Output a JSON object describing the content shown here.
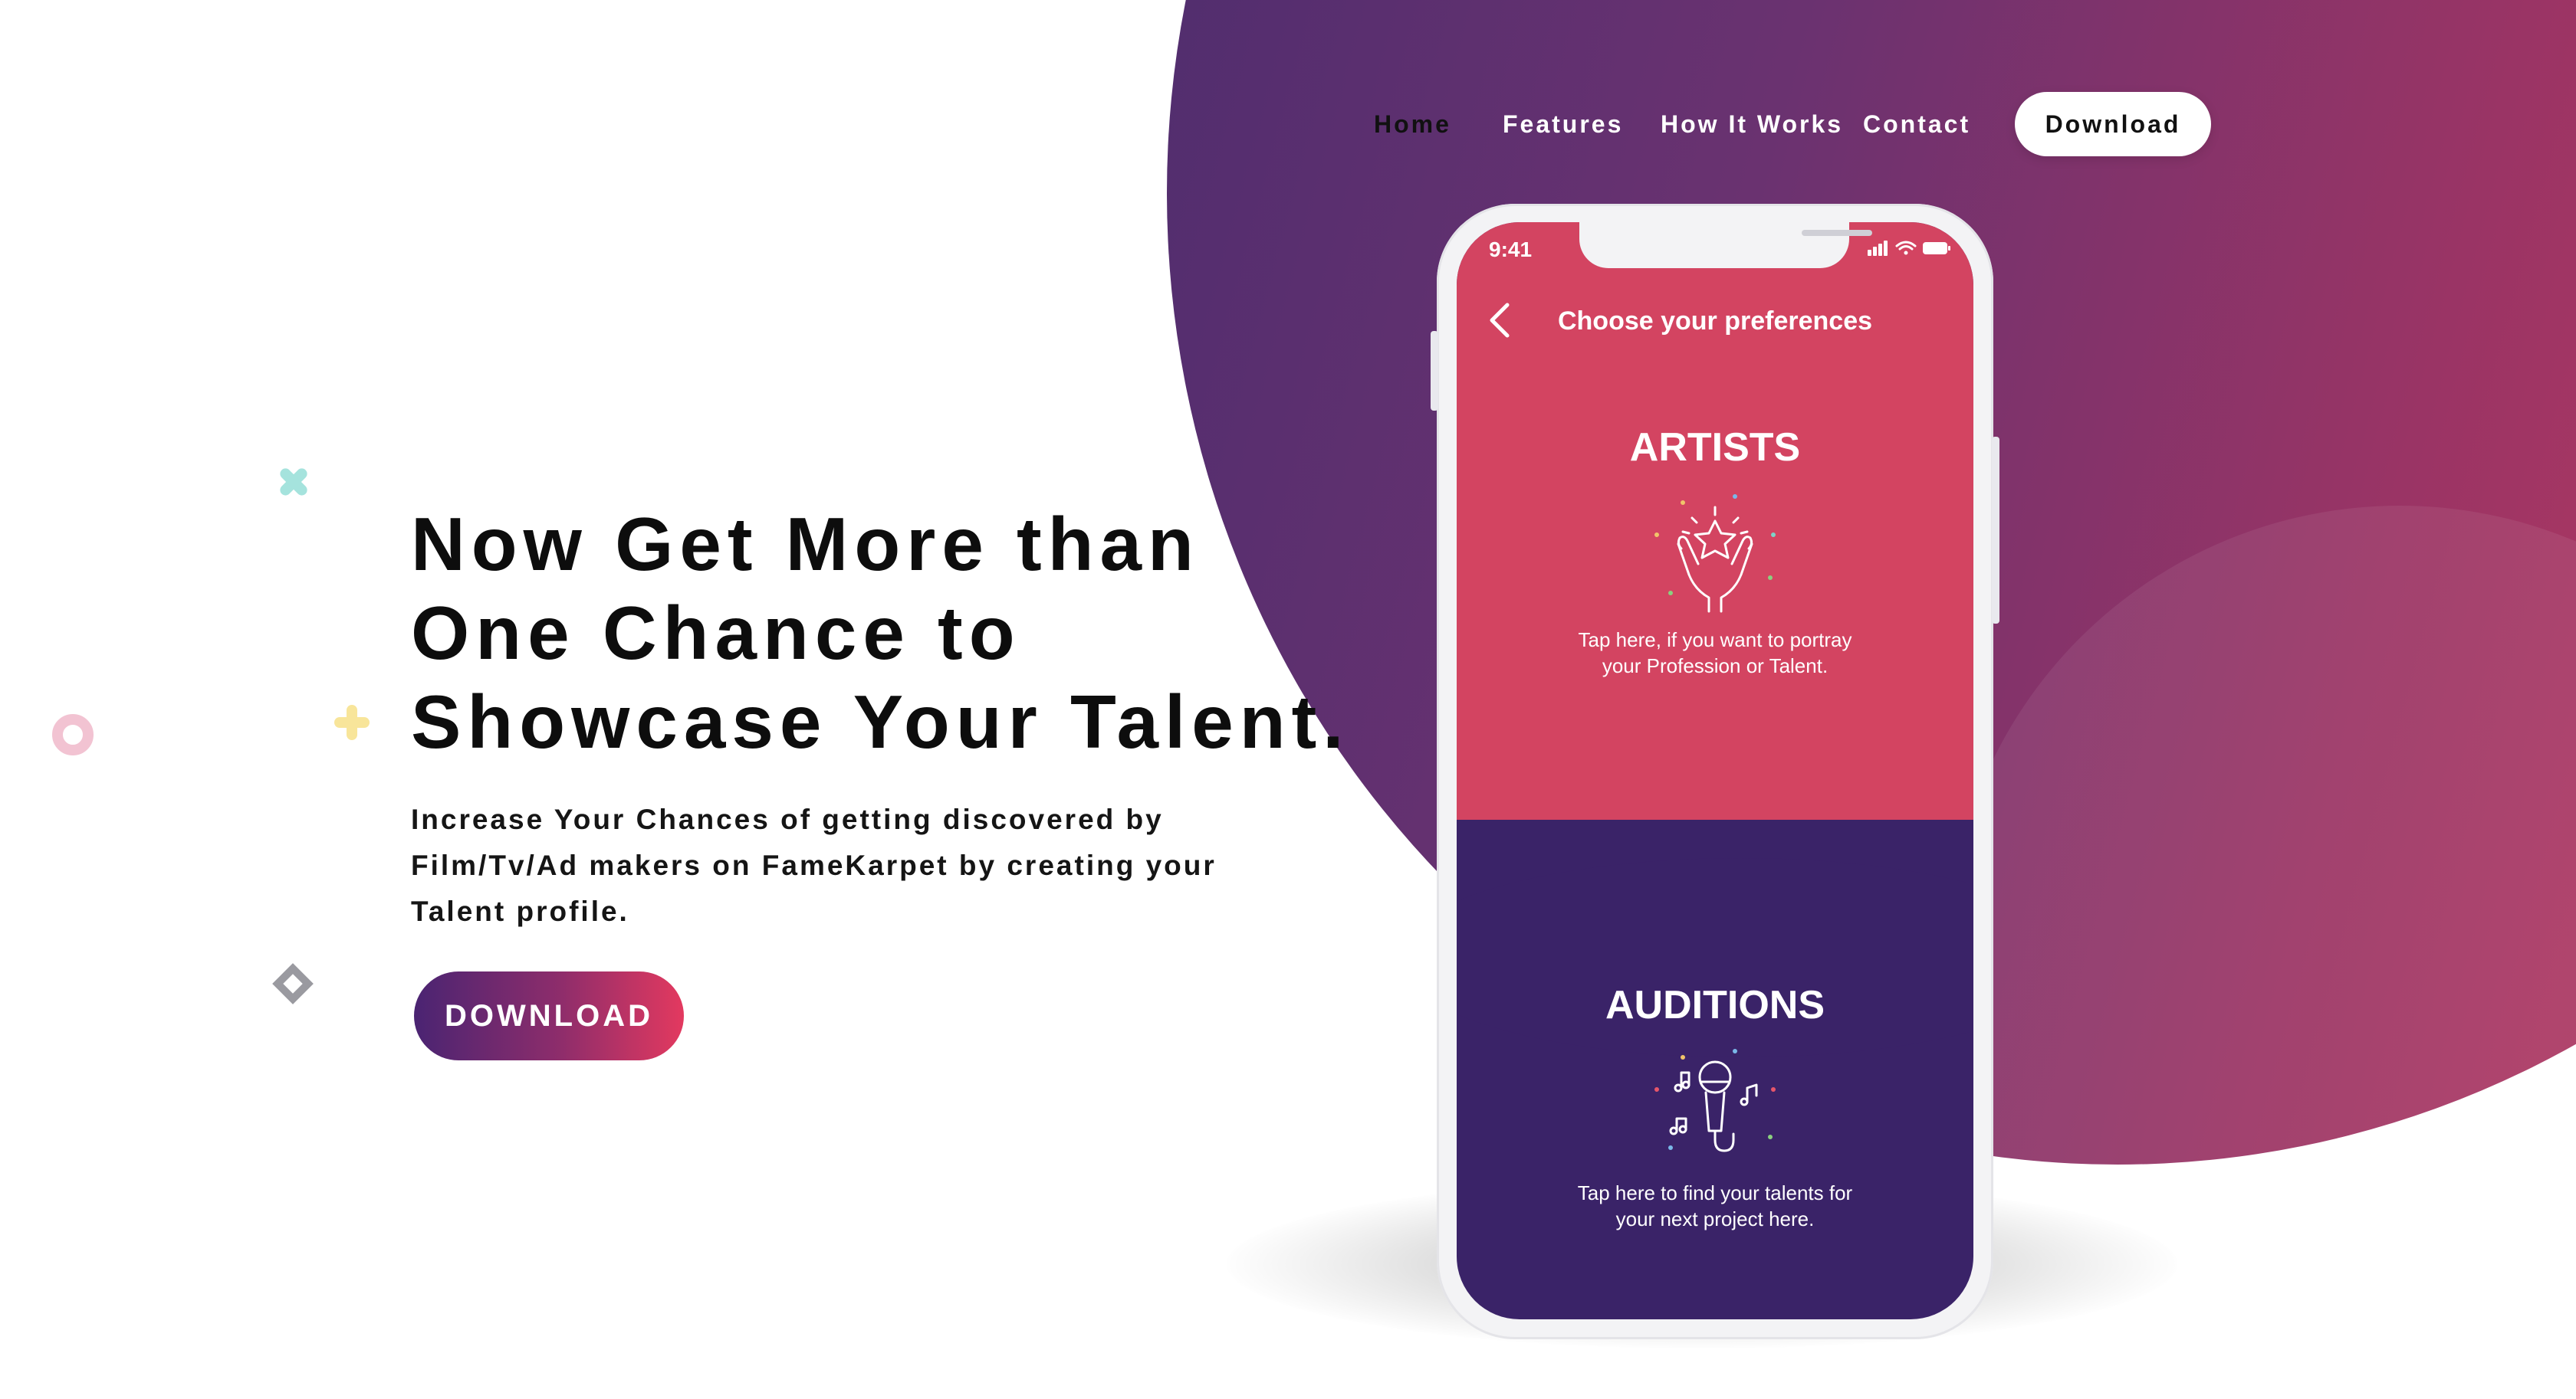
{
  "nav": {
    "links": [
      {
        "label": "Home",
        "active": true
      },
      {
        "label": "Features",
        "active": false
      },
      {
        "label": "How It Works",
        "active": false
      },
      {
        "label": "Contact",
        "active": false
      }
    ],
    "download_label": "Download"
  },
  "hero": {
    "title_lines": [
      "Now Get More than",
      "One Chance to",
      "Showcase Your Talent."
    ],
    "subtitle_lines": [
      "Increase Your Chances of getting discovered by",
      "Film/Tv/Ad makers on FameKarpet by creating your",
      "Talent profile."
    ],
    "cta_label": "DOWNLOAD"
  },
  "phone": {
    "status_time": "9:41",
    "screen_title": "Choose your preferences",
    "artists": {
      "title": "ARTISTS",
      "icon": "hands-star-icon",
      "desc_lines": [
        "Tap here, if you want to portray",
        "your Profession or Talent."
      ]
    },
    "auditions": {
      "title": "AUDITIONS",
      "icon": "microphone-music-icon",
      "desc_lines": [
        "Tap here to find your talents for",
        "your next project here."
      ]
    }
  },
  "colors": {
    "accent_pink": "#d34461",
    "accent_purple": "#3a2368",
    "cta_gradient_start": "#4a2472",
    "cta_gradient_end": "#e3395f",
    "deco_cross_teal": "#a5e3dd",
    "deco_plus_yellow": "#f8e59a",
    "deco_ring_pink": "#f2c3d2",
    "deco_diamond_gray": "#9a9aa0"
  }
}
